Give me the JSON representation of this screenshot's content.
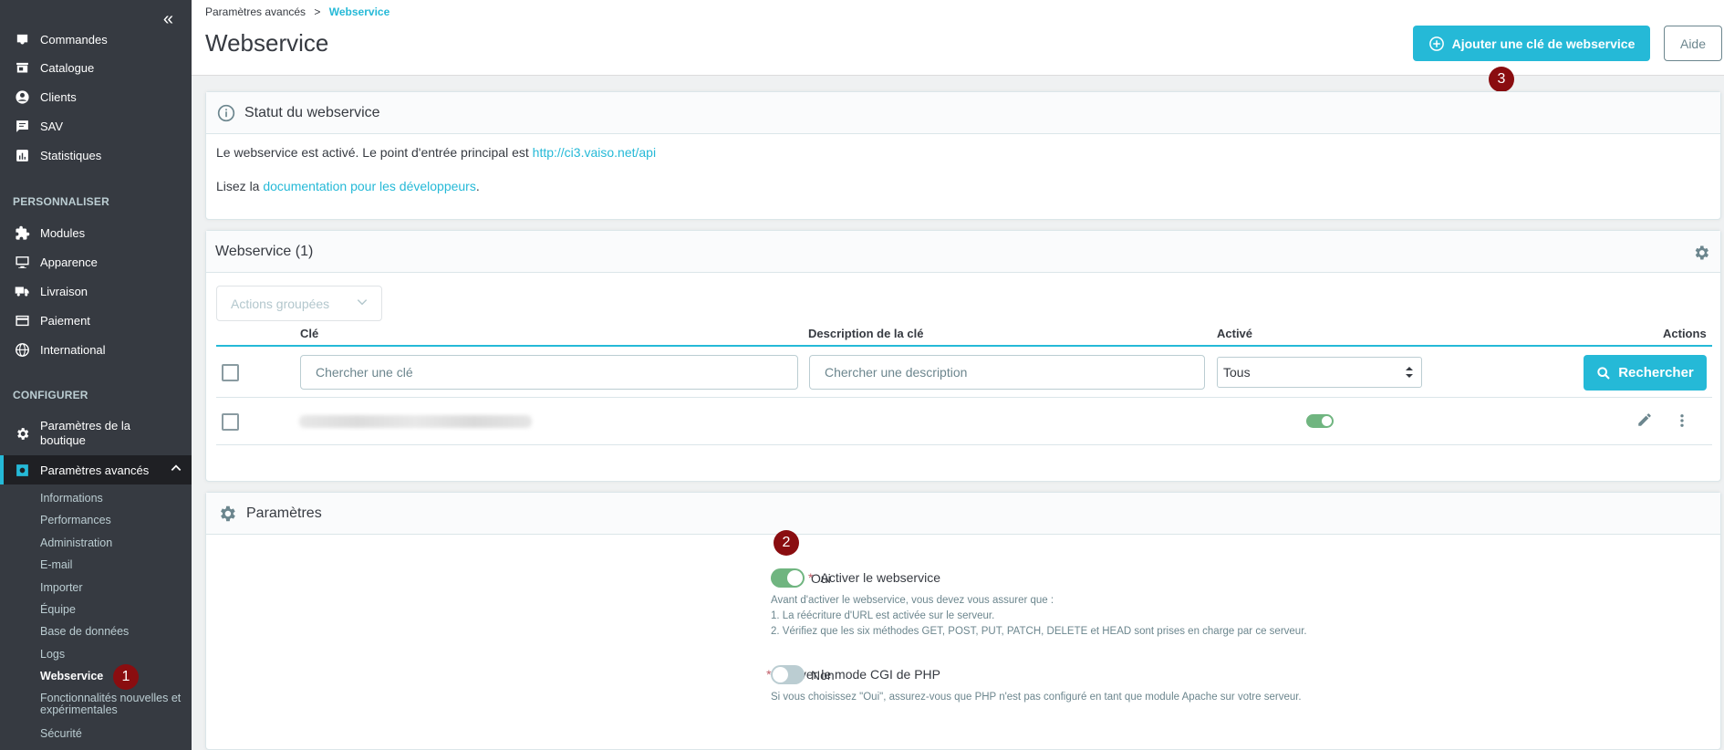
{
  "sidebar": {
    "items": [
      {
        "label": "Commandes",
        "icon": "inbox-icon"
      },
      {
        "label": "Catalogue",
        "icon": "store-icon"
      },
      {
        "label": "Clients",
        "icon": "account-circle-icon"
      },
      {
        "label": "SAV",
        "icon": "chat-icon"
      },
      {
        "label": "Statistiques",
        "icon": "bar-chart-icon"
      }
    ],
    "section_personnaliser": "PERSONNALISER",
    "personnaliser": [
      {
        "label": "Modules",
        "icon": "puzzle-icon"
      },
      {
        "label": "Apparence",
        "icon": "desktop-icon"
      },
      {
        "label": "Livraison",
        "icon": "truck-icon"
      },
      {
        "label": "Paiement",
        "icon": "credit-card-icon"
      },
      {
        "label": "International",
        "icon": "globe-icon"
      }
    ],
    "section_configurer": "CONFIGURER",
    "configurer_shop_line1": "Paramètres de la",
    "configurer_shop_line2": "boutique",
    "configurer_advanced": "Paramètres avancés",
    "sub_items": [
      "Informations",
      "Performances",
      "Administration",
      "E-mail",
      "Importer",
      "Équipe",
      "Base de données",
      "Logs",
      "Webservice",
      "Fonctionnalités nouvelles et",
      "expérimentales",
      "Sécurité"
    ]
  },
  "header": {
    "breadcrumb_parent": "Paramètres avancés",
    "breadcrumb_sep": ">",
    "breadcrumb_current": "Webservice",
    "title": "Webservice",
    "add_button": "Ajouter une clé de webservice",
    "help_button": "Aide"
  },
  "badges": {
    "one": "1",
    "two": "2",
    "three": "3"
  },
  "status": {
    "title": "Statut du webservice",
    "line1_text": "Le webservice est activé. Le point d'entrée principal est ",
    "line1_link": "http://ci3.vaiso.net/api",
    "line2_prefix": "Lisez la ",
    "line2_link": "documentation pour les développeurs",
    "line2_suffix": "."
  },
  "table": {
    "title": "Webservice (1)",
    "bulk_actions": "Actions groupées",
    "columns": {
      "key": "Clé",
      "description": "Description de la clé",
      "active": "Activé",
      "actions": "Actions"
    },
    "filter_key_placeholder": "Chercher une clé",
    "filter_desc_placeholder": "Chercher une description",
    "filter_active_value": "Tous",
    "search_button": "Rechercher",
    "rows": [
      {
        "key": "",
        "description": "",
        "active": true
      }
    ]
  },
  "params": {
    "title": "Paramètres",
    "enable_label": "Activer le webservice",
    "enable_value": "Oui",
    "enable_on": true,
    "enable_help": [
      "Avant d'activer le webservice, vous devez vous assurer que :",
      "1. La réécriture d'URL est activée sur le serveur.",
      "2. Vérifiez que les six méthodes GET, POST, PUT, PATCH, DELETE et HEAD sont prises en charge par ce serveur."
    ],
    "cgi_label": "Activer le mode CGI de PHP",
    "cgi_value": "Non",
    "cgi_on": false,
    "cgi_help": "Si vous choisissez \"Oui\", assurez-vous que PHP n'est pas configuré en tant que module Apache sur votre serveur.",
    "required_mark": "*"
  },
  "colors": {
    "accent": "#25b9d7",
    "toggle_on": "#70b580",
    "toggle_off": "#bbcdd2",
    "badge": "#8a0d10"
  }
}
